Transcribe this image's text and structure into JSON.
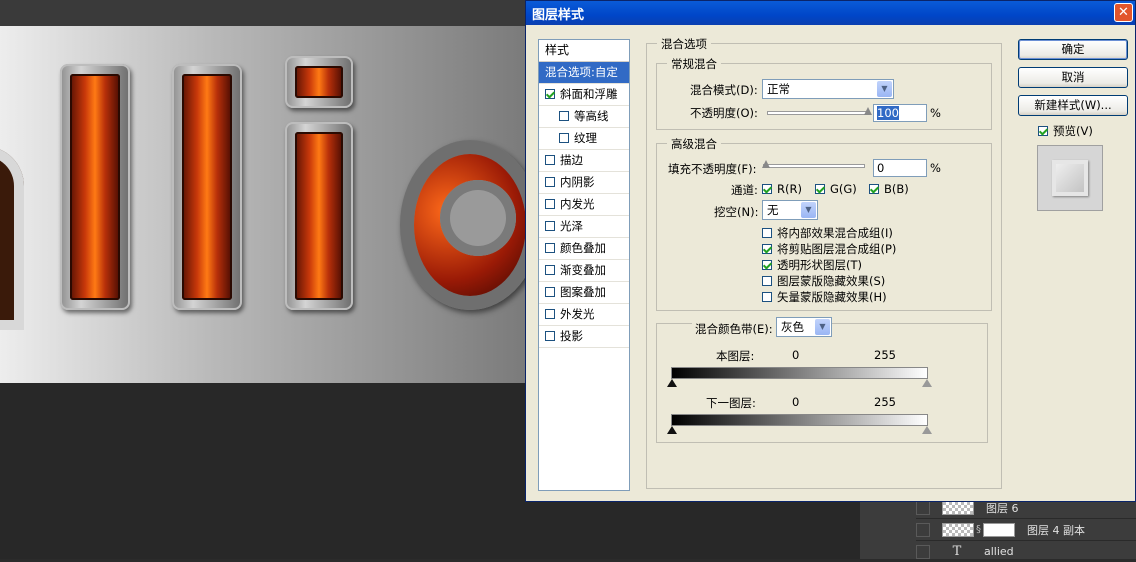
{
  "dialog": {
    "title": "图层样式",
    "close": "✕"
  },
  "style_list": {
    "header": "样式",
    "items": [
      {
        "label": "混合选项:自定",
        "checked": null,
        "active": true
      },
      {
        "label": "斜面和浮雕",
        "checked": true
      },
      {
        "label": "等高线",
        "checked": false,
        "indent": true
      },
      {
        "label": "纹理",
        "checked": false,
        "indent": true
      },
      {
        "label": "描边",
        "checked": false
      },
      {
        "label": "内阴影",
        "checked": false
      },
      {
        "label": "内发光",
        "checked": false
      },
      {
        "label": "光泽",
        "checked": false
      },
      {
        "label": "颜色叠加",
        "checked": false
      },
      {
        "label": "渐变叠加",
        "checked": false
      },
      {
        "label": "图案叠加",
        "checked": false
      },
      {
        "label": "外发光",
        "checked": false
      },
      {
        "label": "投影",
        "checked": false
      }
    ]
  },
  "blend": {
    "group_title": "混合选项",
    "general_title": "常规混合",
    "mode_label": "混合模式(D):",
    "mode_value": "正常",
    "opacity_label": "不透明度(O):",
    "opacity_value": "100",
    "percent": "%",
    "advanced_title": "高级混合",
    "fill_label": "填充不透明度(F):",
    "fill_value": "0",
    "channels_label": "通道:",
    "channel_r": "R(R)",
    "channel_g": "G(G)",
    "channel_b": "B(B)",
    "knockout_label": "挖空(N):",
    "knockout_value": "无",
    "options": [
      {
        "label": "将内部效果混合成组(I)",
        "checked": false
      },
      {
        "label": "将剪贴图层混合成组(P)",
        "checked": true
      },
      {
        "label": "透明形状图层(T)",
        "checked": true
      },
      {
        "label": "图层蒙版隐藏效果(S)",
        "checked": false
      },
      {
        "label": "矢量蒙版隐藏效果(H)",
        "checked": false
      }
    ],
    "band_label": "混合颜色带(E):",
    "band_value": "灰色",
    "this_layer_label": "本图层:",
    "this_layer_min": "0",
    "this_layer_max": "255",
    "under_layer_label": "下一图层:",
    "under_layer_min": "0",
    "under_layer_max": "255"
  },
  "buttons": {
    "ok": "确定",
    "cancel": "取消",
    "new_style": "新建样式(W)...",
    "preview": "预览(V)"
  },
  "layers": [
    {
      "name": "图层 6",
      "type": "raster"
    },
    {
      "name": "图层 4 副本",
      "type": "masked"
    },
    {
      "name": "allied",
      "type": "text",
      "icon": "T"
    }
  ],
  "colors": {
    "title_bar": "#0046c8",
    "dialog_bg": "#ece9d8",
    "selection": "#316ac5"
  }
}
